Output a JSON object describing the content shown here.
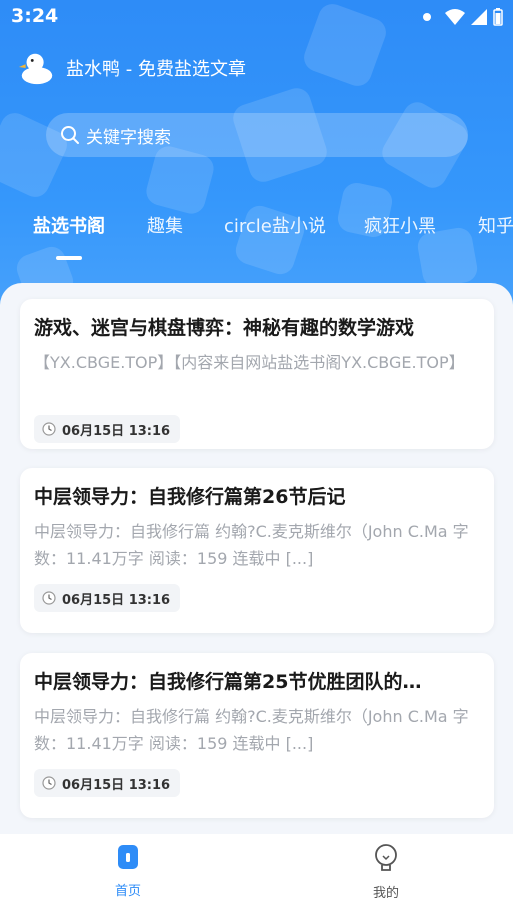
{
  "status_bar": {
    "time": "3:24"
  },
  "app": {
    "title": "盐水鸭 - 免费盐选文章"
  },
  "search": {
    "placeholder": "关键字搜索"
  },
  "tabs": [
    {
      "label": "盐选书阁",
      "active": true
    },
    {
      "label": "趣集",
      "active": false
    },
    {
      "label": "circle盐小说",
      "active": false
    },
    {
      "label": "疯狂小黑",
      "active": false
    },
    {
      "label": "知乎",
      "active": false
    }
  ],
  "articles": [
    {
      "title": "游戏、迷宫与棋盘博弈：神秘有趣的数学游戏",
      "desc": "【YX.CBGE.TOP】【内容来自网站盐选书阁YX.CBGE.TOP】",
      "date": "06月15日 13:16"
    },
    {
      "title": "中层领导力：自我修行篇第26节后记",
      "desc": "中层领导力：自我修行篇 约翰?C.麦克斯维尔（John C.Ma 字数：11.41万字 阅读：159 连载中 [...]",
      "date": "06月15日 13:16"
    },
    {
      "title": "中层领导力：自我修行篇第25节优胜团队的…",
      "desc": "中层领导力：自我修行篇 约翰?C.麦克斯维尔（John C.Ma 字数：11.41万字 阅读：159 连载中 [...]",
      "date": "06月15日 13:16"
    }
  ],
  "bottom_nav": [
    {
      "label": "首页",
      "active": true,
      "icon": "home-icon"
    },
    {
      "label": "我的",
      "active": false,
      "icon": "lightbulb-icon"
    }
  ],
  "colors": {
    "primary": "#2e8cf7",
    "muted_text": "#a3a7ae",
    "nav_inactive": "#555555"
  }
}
